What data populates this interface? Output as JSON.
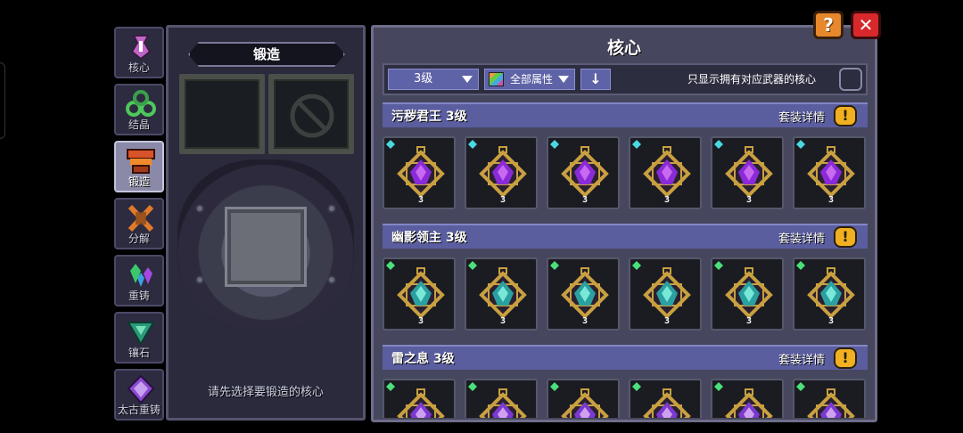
{
  "tabs": [
    {
      "label": "核心",
      "icon": "core-icon",
      "active": false
    },
    {
      "label": "结晶",
      "icon": "crystal-icon",
      "active": false
    },
    {
      "label": "锻造",
      "icon": "anvil-icon",
      "active": true
    },
    {
      "label": "分解",
      "icon": "disassemble-icon",
      "active": false
    },
    {
      "label": "重铸",
      "icon": "recast-icon",
      "active": false
    },
    {
      "label": "镶石",
      "icon": "inlay-icon",
      "active": false
    },
    {
      "label": "太古重铸",
      "icon": "ancient-recast-icon",
      "active": false
    }
  ],
  "forge": {
    "title": "锻造",
    "hint": "请先选择要锻造的核心"
  },
  "core": {
    "title": "核心",
    "filter": {
      "level": "3级",
      "attribute": "全部属性",
      "sort_icon": "↓",
      "only_owned_label": "只显示拥有对应武器的核心",
      "only_owned_checked": false
    },
    "sets": [
      {
        "name": "污秽君王 3级",
        "detail": "套装详情",
        "info": "!",
        "theme": "purple",
        "level_mark": "3",
        "count": 6
      },
      {
        "name": "幽影领主 3级",
        "detail": "套装详情",
        "info": "!",
        "theme": "teal",
        "level_mark": "3",
        "count": 6
      },
      {
        "name": "雷之息  3级",
        "detail": "套装详情",
        "info": "!",
        "theme": "violet",
        "level_mark": "3",
        "count": 6
      }
    ]
  },
  "buttons": {
    "help": "?",
    "close": "✕"
  },
  "colors": {
    "panel": "#46475e",
    "set_header": "#5a5d9e",
    "help": "#e8882c",
    "close": "#d8282c",
    "info": "#f0b022"
  }
}
